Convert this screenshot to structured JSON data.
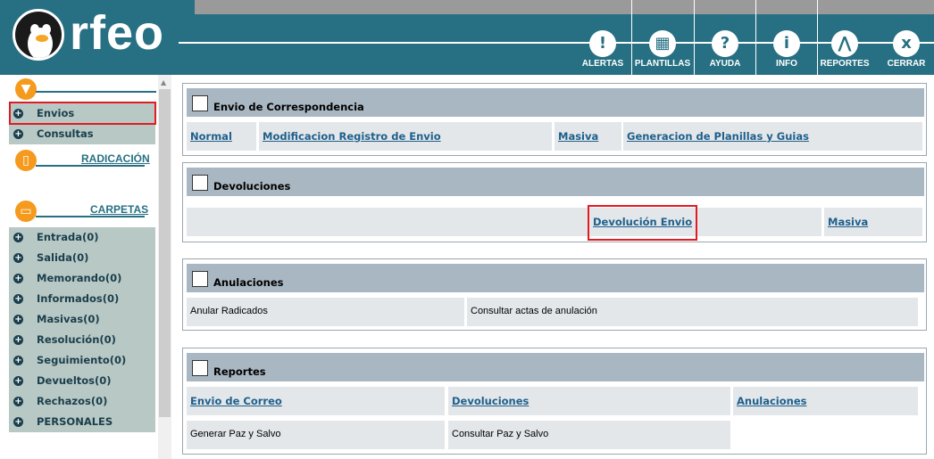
{
  "header": {
    "logo_text": "rfeo",
    "toolbar": [
      {
        "id": "alertas",
        "label": "ALERTAS",
        "glyph": "!"
      },
      {
        "id": "plantillas",
        "label": "PLANTILLAS",
        "glyph": "▦"
      },
      {
        "id": "ayuda",
        "label": "AYUDA",
        "glyph": "?"
      },
      {
        "id": "info",
        "label": "INFO",
        "glyph": "i"
      },
      {
        "id": "reportes",
        "label": "REPORTES",
        "glyph": "⋀"
      },
      {
        "id": "cerrar",
        "label": "CERRAR",
        "glyph": "x"
      }
    ]
  },
  "sidebar": {
    "top_items": [
      {
        "label": "Envios"
      },
      {
        "label": "Consultas"
      }
    ],
    "radicacion_label": "RADICACIÓN",
    "carpetas_label": "CARPETAS",
    "carpetas": [
      {
        "label": "Entrada(0)"
      },
      {
        "label": "Salida(0)"
      },
      {
        "label": "Memorando(0)"
      },
      {
        "label": "Informados(0)"
      },
      {
        "label": "Masivas(0)"
      },
      {
        "label": "Resolución(0)"
      },
      {
        "label": "Seguimiento(0)"
      },
      {
        "label": "Devueltos(0)"
      },
      {
        "label": "Rechazos(0)"
      },
      {
        "label": "PERSONALES"
      }
    ]
  },
  "panels": {
    "envio": {
      "title": "Envio de Correspondencia",
      "links": [
        "Normal",
        "Modificacion Registro de Envio",
        "Masiva",
        "Generacion de Planillas y Guias"
      ]
    },
    "devoluciones": {
      "title": "Devoluciones",
      "links": [
        "Devolución Envio",
        "Masiva"
      ]
    },
    "anulaciones": {
      "title": "Anulaciones",
      "items": [
        "Anular Radicados",
        "Consultar actas de anulación"
      ]
    },
    "reportes": {
      "title": "Reportes",
      "links": [
        "Envio de Correo",
        "Devoluciones",
        "Anulaciones"
      ],
      "items": [
        "Generar Paz y Salvo",
        "Consultar Paz y Salvo"
      ]
    }
  },
  "colors": {
    "header_bg": "#277083",
    "accent_orange": "#f59a1c",
    "highlight_red": "#e21b23",
    "panel_header": "#a9b7c2",
    "link": "#1f5f8b"
  }
}
